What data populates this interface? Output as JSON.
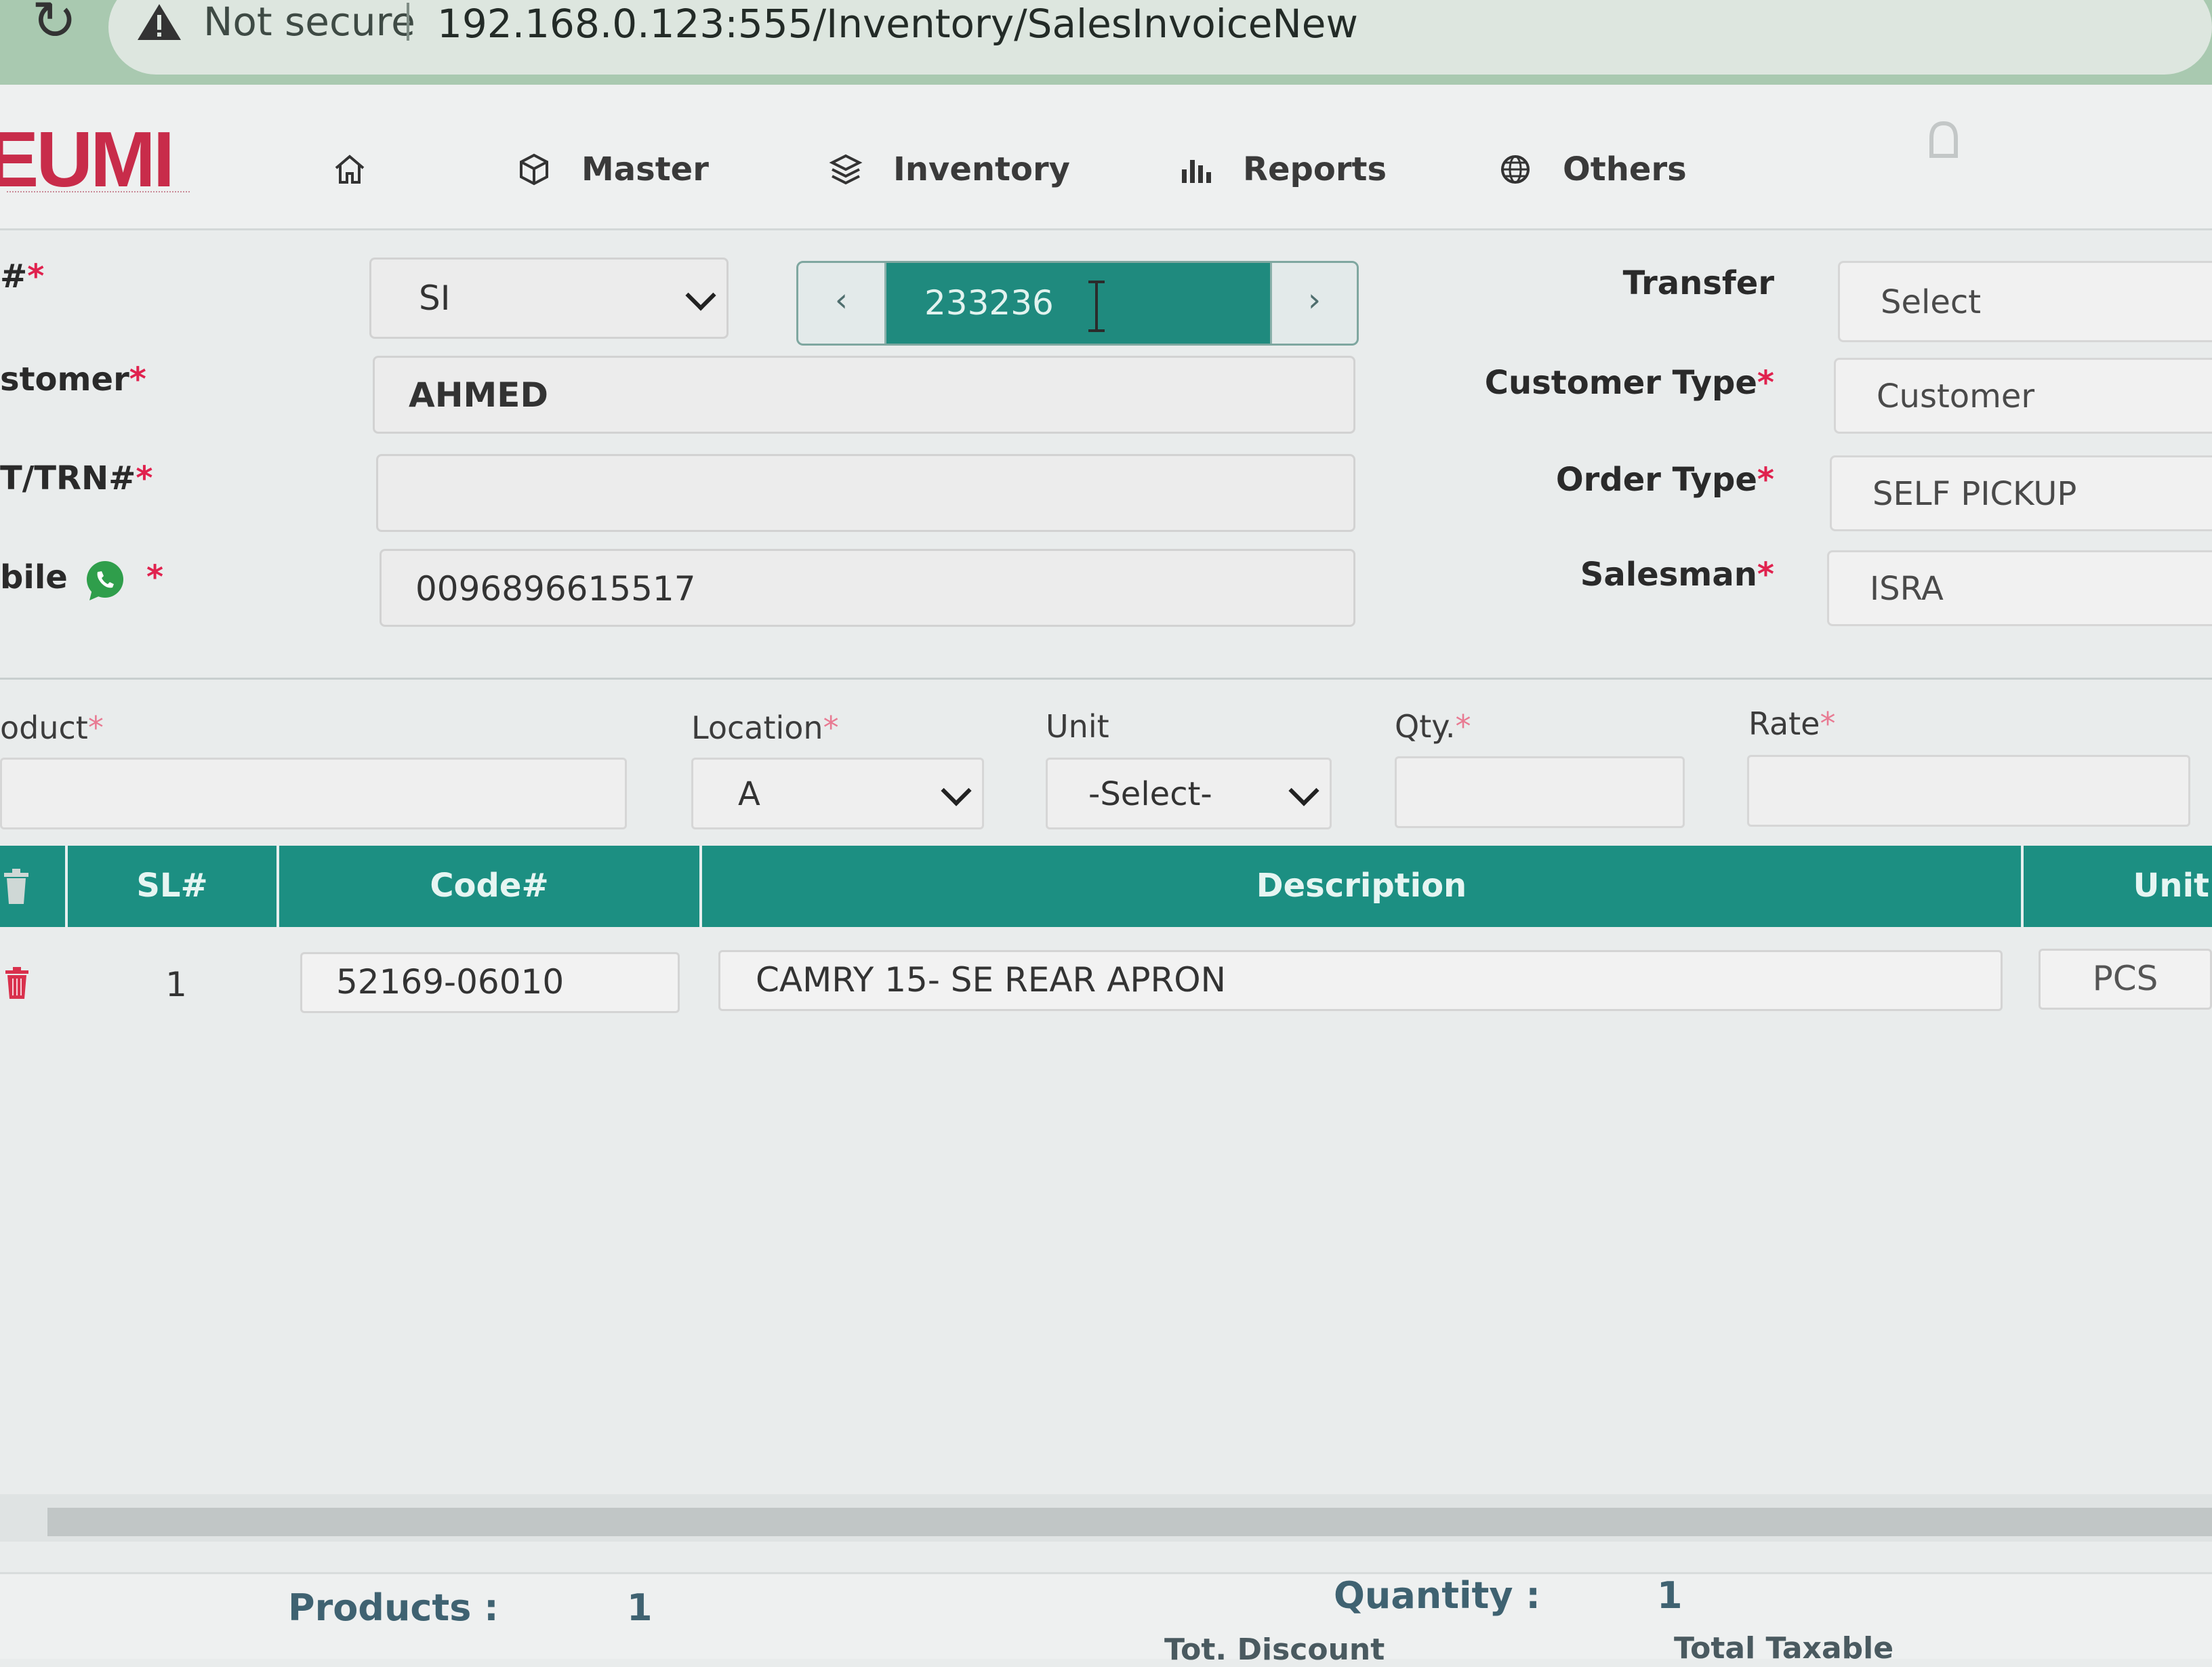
{
  "browser": {
    "security_label": "Not secure",
    "url": "192.168.0.123:555/Inventory/SalesInvoiceNew"
  },
  "app": {
    "logo_text": "EUMI",
    "brand_color": "#c82c4a",
    "accent_color": "#1c8f82"
  },
  "nav": {
    "items": [
      {
        "label": "",
        "icon": "home-icon"
      },
      {
        "label": "Master",
        "icon": "cube-icon"
      },
      {
        "label": "Inventory",
        "icon": "layers-icon"
      },
      {
        "label": "Reports",
        "icon": "bar-chart-icon"
      },
      {
        "label": "Others",
        "icon": "globe-icon"
      }
    ]
  },
  "form": {
    "invoice_label": "#",
    "prefix_value": "SI",
    "invoice_number": "233236",
    "customer_label": "stomer",
    "customer_value": "AHMED",
    "trn_label": "T/TRN#",
    "trn_value": "",
    "mobile_label": "bile",
    "mobile_value": "0096896615517",
    "transfer_label": "Transfer",
    "transfer_value": "Select",
    "customer_type_label": "Customer Type",
    "customer_type_value": "Customer",
    "order_type_label": "Order Type",
    "order_type_value": "SELF PICKUP",
    "salesman_label": "Salesman",
    "salesman_value": "ISRA",
    "required_mark": "*"
  },
  "entry": {
    "product_label": "oduct",
    "location_label": "Location",
    "location_value": "A",
    "unit_label": "Unit",
    "unit_value": "-Select-",
    "qty_label": "Qty.",
    "rate_label": "Rate"
  },
  "table": {
    "columns": [
      "SL#",
      "Code#",
      "Description",
      "Unit"
    ],
    "rows": [
      {
        "sl": "1",
        "code": "52169-06010",
        "description": "CAMRY 15- SE REAR APRON",
        "unit": "PCS"
      }
    ]
  },
  "summary": {
    "products_label": "Products :",
    "products_value": "1",
    "quantity_label": "Quantity :",
    "quantity_value": "1",
    "tot_discount_label": "Tot. Discount",
    "total_taxable_label": "Total Taxable"
  }
}
